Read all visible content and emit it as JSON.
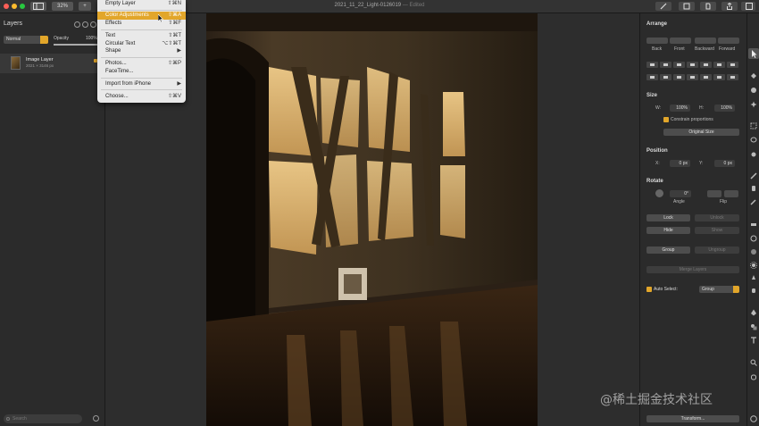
{
  "window": {
    "document_title": "2021_11_22_Light-0126019",
    "edited_label": "— Edited",
    "zoom_label": "32%",
    "add_label": "+"
  },
  "layers_panel": {
    "title": "Layers",
    "blend_mode": "Normal",
    "opacity_label": "Opacity",
    "opacity_value": "100%",
    "opacity_fraction": 1.0,
    "layers": [
      {
        "name": "Image Layer",
        "size": "2021 × 3146 px"
      }
    ],
    "search_placeholder": "Search"
  },
  "insert_menu": {
    "items": [
      {
        "label": "Empty Layer",
        "shortcut": "⇧⌘N"
      },
      {
        "label": "Color Adjustments",
        "shortcut": "⇧⌘A",
        "highlighted": true
      },
      {
        "label": "Effects",
        "shortcut": "⇧⌘F"
      },
      {
        "label": "Text",
        "shortcut": "⇧⌘T"
      },
      {
        "label": "Circular Text",
        "shortcut": "⌥⇧⌘T"
      },
      {
        "label": "Shape",
        "shortcut": "▶"
      },
      {
        "label": "Photos...",
        "shortcut": "⇧⌘P"
      },
      {
        "label": "FaceTime...",
        "shortcut": ""
      },
      {
        "label": "Import from iPhone",
        "shortcut": "▶"
      },
      {
        "label": "Choose...",
        "shortcut": "⇧⌘V"
      }
    ]
  },
  "inspector": {
    "arrange": {
      "title": "Arrange",
      "back": "Back",
      "front": "Front",
      "backward": "Backward",
      "forward": "Forward"
    },
    "size": {
      "title": "Size",
      "w_label": "W:",
      "w_value": "100%",
      "h_label": "H:",
      "h_value": "100%",
      "constrain_label": "Constrain proportions",
      "original_size": "Original Size"
    },
    "position": {
      "title": "Position",
      "x_label": "X:",
      "x_value": "0 px",
      "y_label": "Y:",
      "y_value": "0 px"
    },
    "rotate": {
      "title": "Rotate",
      "angle_value": "0°",
      "angle_label": "Angle",
      "flip_label": "Flip"
    },
    "actions": {
      "lock": "Lock",
      "unlock": "Unlock",
      "hide": "Hide",
      "show": "Show",
      "group": "Group",
      "ungroup": "Ungroup",
      "merge": "Merge Layers"
    },
    "auto_select": {
      "label": "Auto Select:",
      "value": "Group"
    },
    "transform": "Transform..."
  },
  "watermark": "@稀土掘金技术社区",
  "colors": {
    "accent": "#e2a62a",
    "panel": "#2b2b2b",
    "canvas_bg": "#2d2d2d",
    "menu_bg": "#e9e9e9"
  },
  "icons": {
    "tools": [
      "arrow-select-icon",
      "paint-bucket-icon",
      "clone-icon",
      "magic-wand-icon",
      "rect-select-icon",
      "lasso-icon",
      "quick-select-icon",
      "brush-icon",
      "paint-icon",
      "pencil-icon",
      "eraser-icon",
      "smudge-icon",
      "blur-icon",
      "sponge-icon",
      "retouch-icon",
      "pen-icon",
      "shape-icon",
      "text-icon",
      "zoom-icon",
      "hand-icon",
      "color-icon"
    ]
  }
}
